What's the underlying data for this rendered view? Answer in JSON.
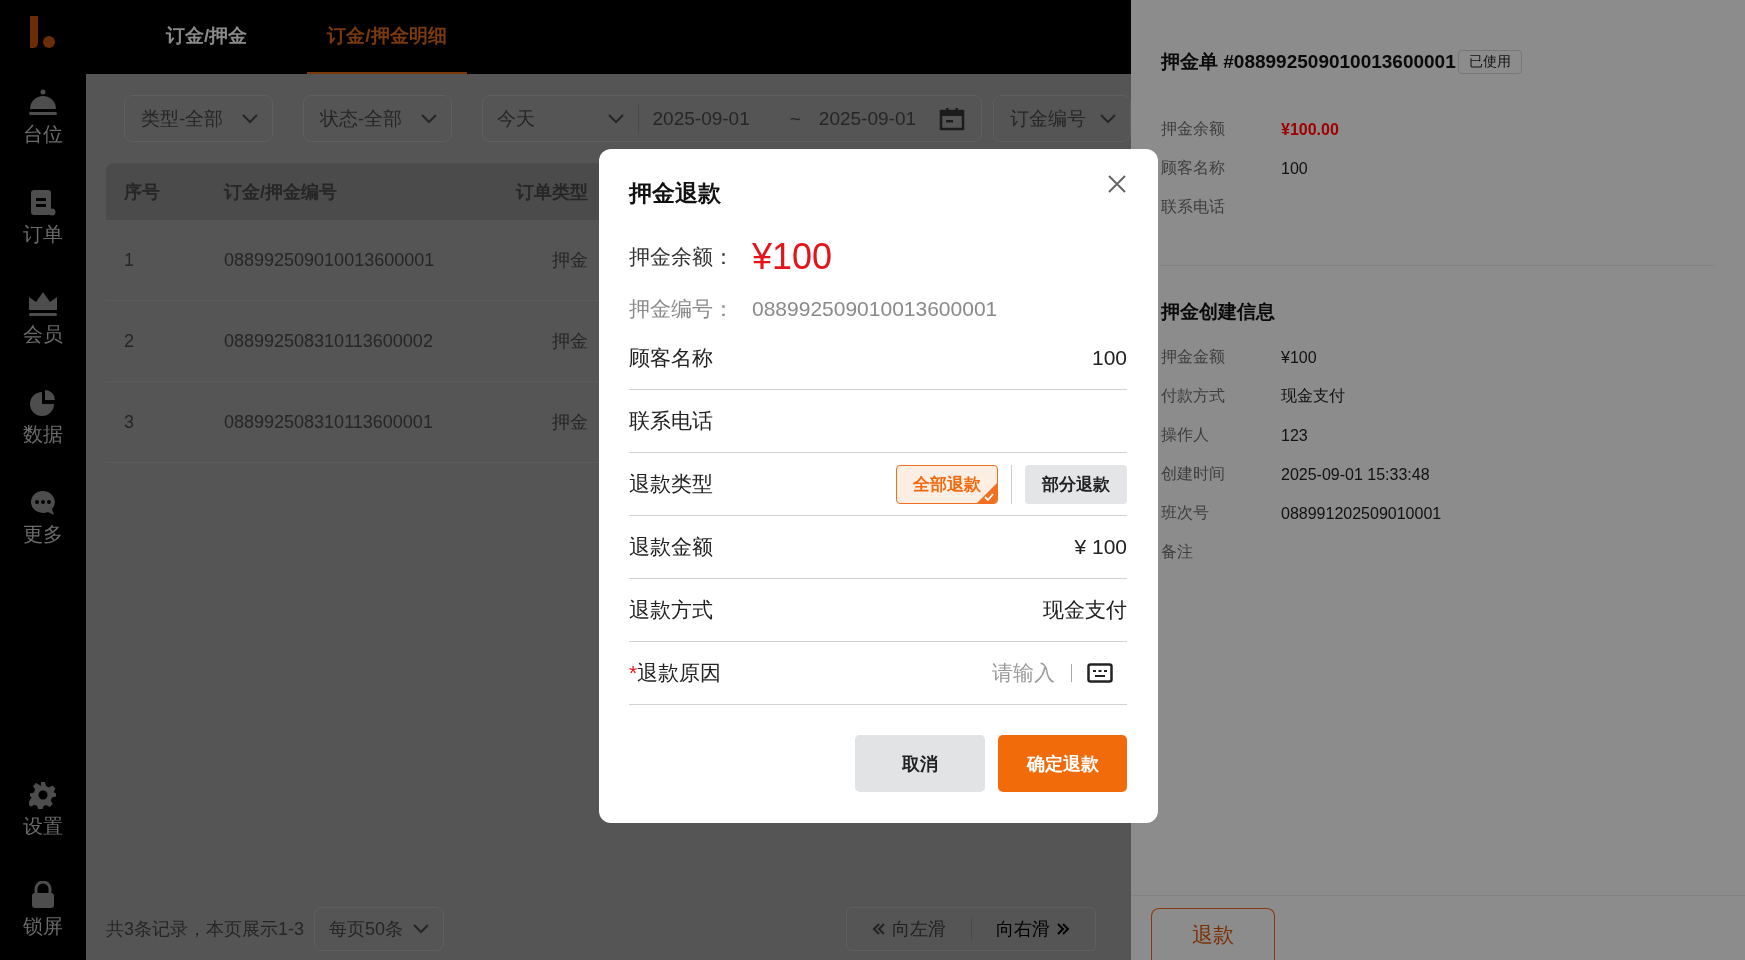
{
  "sidebar": {
    "items": [
      {
        "label": "台位"
      },
      {
        "label": "订单"
      },
      {
        "label": "会员"
      },
      {
        "label": "数据"
      },
      {
        "label": "更多"
      }
    ],
    "bottom_items": [
      {
        "label": "设置"
      },
      {
        "label": "锁屏"
      }
    ]
  },
  "tabs": [
    {
      "label": "订金/押金",
      "selected": false
    },
    {
      "label": "订金/押金明细",
      "selected": true
    }
  ],
  "filters": {
    "selects": [
      {
        "label": "类型-全部"
      },
      {
        "label": "状态-全部"
      }
    ],
    "period": "今天",
    "date_start": "2025-09-01",
    "date_separator": "~",
    "date_end": "2025-09-01",
    "search_type": "订金编号"
  },
  "table": {
    "columns": [
      "序号",
      "订金/押金编号",
      "订单类型"
    ],
    "rows": [
      [
        "1",
        "088992509010013600001",
        "押金"
      ],
      [
        "2",
        "088992508310113600002",
        "押金"
      ],
      [
        "3",
        "088992508310113600001",
        "押金"
      ]
    ]
  },
  "footer": {
    "summary": "共3条记录，本页展示1-3",
    "page_size": "每页50条",
    "prev": {
      "label": "向左滑",
      "disabled": true
    },
    "next": {
      "label": "向右滑",
      "disabled": false
    }
  },
  "detail": {
    "title": "押金单 #088992509010013600001",
    "badge": "已使用",
    "fields": [
      {
        "kind": "amount",
        "label": "押金余额",
        "value": "¥100.00"
      },
      {
        "kind": "text",
        "label": "顾客名称",
        "value": "100"
      },
      {
        "kind": "text",
        "label": "联系电话"
      }
    ],
    "section_title": "押金创建信息",
    "creation_fields": [
      {
        "label": "押金金额",
        "value": "¥100"
      },
      {
        "label": "付款方式",
        "value": "现金支付"
      },
      {
        "label": "操作人",
        "value": "123"
      },
      {
        "label": "创建时间",
        "value": "2025-09-01 15:33:48"
      },
      {
        "label": "班次号",
        "value": "088991202509010001"
      },
      {
        "label": "备注"
      }
    ],
    "action": "退款"
  },
  "dialog": {
    "title": "押金退款",
    "balance": {
      "label": "押金余额：",
      "value": "¥100"
    },
    "deposit_no": {
      "label": "押金编号：",
      "value": "088992509010013600001"
    },
    "rows": [
      {
        "kind": "value",
        "label": "顾客名称",
        "value": "100"
      },
      {
        "kind": "value",
        "label": "联系电话"
      },
      {
        "kind": "choice",
        "label": "退款类型",
        "options": [
          {
            "label": "全部退款",
            "selected": true
          },
          {
            "label": "部分退款",
            "selected": false
          }
        ]
      },
      {
        "kind": "value",
        "label": "退款金额",
        "value": "¥ 100"
      },
      {
        "kind": "value",
        "label": "退款方式",
        "value": "现金支付"
      },
      {
        "kind": "input",
        "label": "退款原因",
        "required_mark": "*",
        "placeholder": "请输入"
      }
    ],
    "buttons": [
      {
        "label": "取消",
        "kind": "secondary"
      },
      {
        "label": "确定退款",
        "kind": "primary"
      }
    ]
  }
}
